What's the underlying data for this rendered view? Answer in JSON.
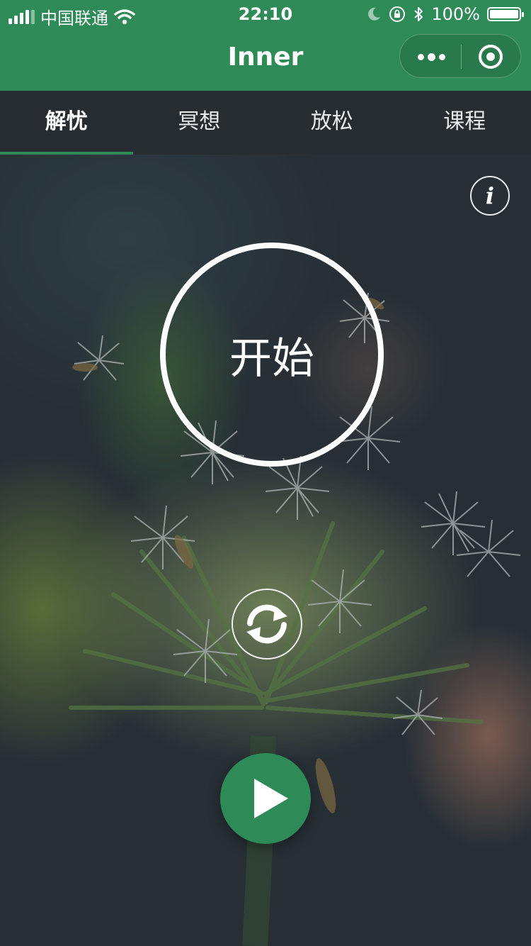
{
  "status_bar": {
    "carrier": "中国联通",
    "time": "22:10",
    "battery_text": "100%",
    "battery_level": 1.0,
    "icons": [
      "signal-icon",
      "wifi-icon",
      "moon-icon",
      "orientation-lock-icon",
      "bluetooth-icon",
      "battery-icon"
    ]
  },
  "nav": {
    "title": "Inner",
    "icons": [
      "more-icon",
      "close-miniprogram-icon"
    ]
  },
  "tabs": [
    {
      "label": "解忧",
      "active": true
    },
    {
      "label": "冥想",
      "active": false
    },
    {
      "label": "放松",
      "active": false
    },
    {
      "label": "课程",
      "active": false
    }
  ],
  "main": {
    "info_glyph": "i",
    "start_label": "开始",
    "icons": [
      "info-icon",
      "refresh-icon",
      "play-icon"
    ]
  },
  "colors": {
    "primary_green": "#2e8b57",
    "tab_bar_bg": "#262c30",
    "text_white": "#ffffff"
  }
}
